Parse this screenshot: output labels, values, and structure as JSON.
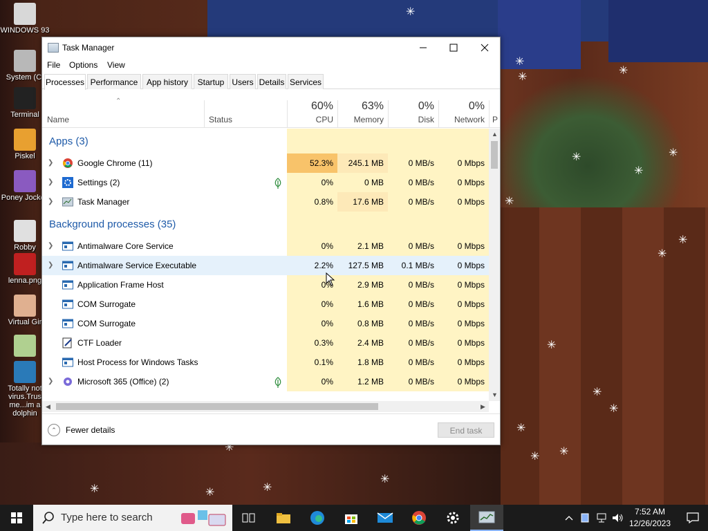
{
  "desktop": {
    "icons": [
      {
        "label": "WINDOWS 93"
      },
      {
        "label": "System (C:"
      },
      {
        "label": "Terminal"
      },
      {
        "label": "Piskel"
      },
      {
        "label": "Poney Jockey"
      },
      {
        "label": "Robby"
      },
      {
        "label": "lenna.png"
      },
      {
        "label": "Virtual Gir"
      },
      {
        "label": ""
      },
      {
        "label": "Totally not virus.Trus me...im a dolphin"
      }
    ]
  },
  "window": {
    "title": "Task Manager",
    "menu": [
      "File",
      "Options",
      "View"
    ],
    "tabs": [
      "Processes",
      "Performance",
      "App history",
      "Startup",
      "Users",
      "Details",
      "Services"
    ],
    "active_tab": "Processes",
    "columns": {
      "name": "Name",
      "status": "Status",
      "cpu": {
        "pct": "60%",
        "label": "CPU"
      },
      "memory": {
        "pct": "63%",
        "label": "Memory"
      },
      "disk": {
        "pct": "0%",
        "label": "Disk"
      },
      "network": {
        "pct": "0%",
        "label": "Network"
      },
      "power": "P"
    },
    "groups": [
      {
        "label": "Apps (3)"
      },
      {
        "label": "Background processes (35)"
      }
    ],
    "apps": [
      {
        "name": "Google Chrome (11)",
        "icon": "chrome-icon",
        "expand": true,
        "leaf": false,
        "cpu": "52.3%",
        "mem": "245.1 MB",
        "disk": "0 MB/s",
        "net": "0 Mbps"
      },
      {
        "name": "Settings (2)",
        "icon": "settings-icon",
        "expand": true,
        "leaf": true,
        "cpu": "0%",
        "mem": "0 MB",
        "disk": "0 MB/s",
        "net": "0 Mbps"
      },
      {
        "name": "Task Manager",
        "icon": "task-manager-icon",
        "expand": true,
        "leaf": false,
        "cpu": "0.8%",
        "mem": "17.6 MB",
        "disk": "0 MB/s",
        "net": "0 Mbps"
      }
    ],
    "background": [
      {
        "name": "Antimalware Core Service",
        "icon": "service-icon",
        "expand": true,
        "leaf": false,
        "cpu": "0%",
        "mem": "2.1 MB",
        "disk": "0 MB/s",
        "net": "0 Mbps"
      },
      {
        "name": "Antimalware Service Executable",
        "icon": "service-icon",
        "expand": true,
        "leaf": false,
        "cpu": "2.2%",
        "mem": "127.5 MB",
        "disk": "0.1 MB/s",
        "net": "0 Mbps"
      },
      {
        "name": "Application Frame Host",
        "icon": "service-icon",
        "expand": false,
        "leaf": false,
        "cpu": "0%",
        "mem": "2.9 MB",
        "disk": "0 MB/s",
        "net": "0 Mbps"
      },
      {
        "name": "COM Surrogate",
        "icon": "service-icon",
        "expand": false,
        "leaf": false,
        "cpu": "0%",
        "mem": "1.6 MB",
        "disk": "0 MB/s",
        "net": "0 Mbps"
      },
      {
        "name": "COM Surrogate",
        "icon": "service-icon",
        "expand": false,
        "leaf": false,
        "cpu": "0%",
        "mem": "0.8 MB",
        "disk": "0 MB/s",
        "net": "0 Mbps"
      },
      {
        "name": "CTF Loader",
        "icon": "ctf-loader-icon",
        "expand": false,
        "leaf": false,
        "cpu": "0.3%",
        "mem": "2.4 MB",
        "disk": "0 MB/s",
        "net": "0 Mbps"
      },
      {
        "name": "Host Process for Windows Tasks",
        "icon": "service-icon",
        "expand": false,
        "leaf": false,
        "cpu": "0.1%",
        "mem": "1.8 MB",
        "disk": "0 MB/s",
        "net": "0 Mbps"
      },
      {
        "name": "Microsoft 365 (Office) (2)",
        "icon": "office-icon",
        "expand": true,
        "leaf": true,
        "cpu": "0%",
        "mem": "1.2 MB",
        "disk": "0 MB/s",
        "net": "0 Mbps"
      }
    ],
    "footer": {
      "fewer_details": "Fewer details",
      "end_task": "End task"
    }
  },
  "taskbar": {
    "search_placeholder": "Type here to search",
    "time": "7:52 AM",
    "date": "12/26/2023"
  },
  "colors": {
    "heat_high": "#f8c36a",
    "heat_med": "#fde9b8",
    "heat_low": "#fff4c4",
    "group_text": "#1e5aa8",
    "hover_row": "#e5f1fb"
  }
}
